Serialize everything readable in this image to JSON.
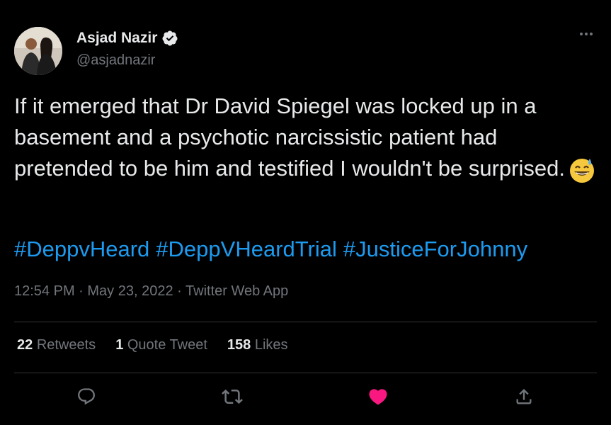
{
  "author": {
    "name": "Asjad Nazir",
    "handle": "@asjadnazir",
    "verified": true,
    "avatar_icon": "avatar-photo"
  },
  "tweet": {
    "text": "If it emerged that Dr David Spiegel was locked up in a basement and a psychotic narcissistic patient had pretended to be him and testified I wouldn't be surprised.",
    "emoji": "sweat-smile-emoji",
    "hashtags": [
      "#DeppvHeard",
      "#DeppVHeardTrial",
      "#JusticeForJohnny"
    ]
  },
  "meta": {
    "time": "12:54 PM",
    "sep1": " · ",
    "date": "May 23, 2022",
    "sep2": " · ",
    "source": "Twitter Web App"
  },
  "stats": {
    "retweets_count": "22",
    "retweets_label": "Retweets",
    "quotes_count": "1",
    "quotes_label": "Quote Tweet",
    "likes_count": "158",
    "likes_label": "Likes"
  },
  "actions": [
    "reply-icon",
    "retweet-icon",
    "like-icon",
    "share-icon"
  ],
  "colors": {
    "background": "#000000",
    "text": "#e7e9ea",
    "secondary": "#71767b",
    "link": "#1d9bf0",
    "like": "#f91880",
    "divider": "#2f3336"
  }
}
